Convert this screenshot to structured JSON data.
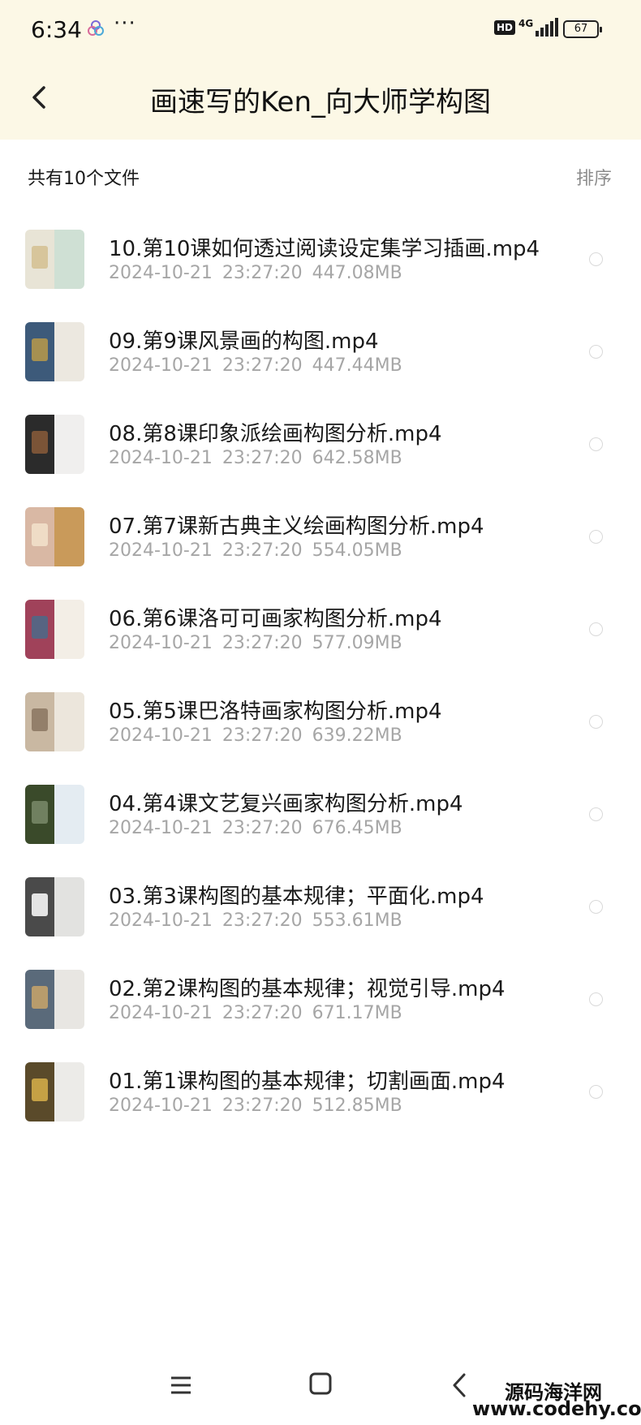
{
  "status_bar": {
    "time": "6:34",
    "more": "···",
    "hd": "HD",
    "network": "4G",
    "battery": "67"
  },
  "header": {
    "title": "画速写的Ken_向大师学构图"
  },
  "list_header": {
    "count_label": "共有10个文件",
    "sort_label": "排序"
  },
  "files": [
    {
      "name": "10.第10课如何透过阅读设定集学习插画.mp4",
      "date": "2024-10-21",
      "time": "23:27:20",
      "size": "447.08MB",
      "thumb": [
        "#e8e4d6",
        "#cfe0d4",
        "#d4c090"
      ]
    },
    {
      "name": "09.第9课风景画的构图.mp4",
      "date": "2024-10-21",
      "time": "23:27:20",
      "size": "447.44MB",
      "thumb": [
        "#3d5a7a",
        "#ece8e0",
        "#b89a4a"
      ]
    },
    {
      "name": "08.第8课印象派绘画构图分析.mp4",
      "date": "2024-10-21",
      "time": "23:27:20",
      "size": "642.58MB",
      "thumb": [
        "#2b2b2b",
        "#f0efee",
        "#8a5c3a"
      ]
    },
    {
      "name": "07.第7课新古典主义绘画构图分析.mp4",
      "date": "2024-10-21",
      "time": "23:27:20",
      "size": "554.05MB",
      "thumb": [
        "#d9b8a4",
        "#c99a5a",
        "#f2e2cc"
      ]
    },
    {
      "name": "06.第6课洛可可画家构图分析.mp4",
      "date": "2024-10-21",
      "time": "23:27:20",
      "size": "577.09MB",
      "thumb": [
        "#a0425a",
        "#f3eee6",
        "#4a6a8a"
      ]
    },
    {
      "name": "05.第5课巴洛特画家构图分析.mp4",
      "date": "2024-10-21",
      "time": "23:27:20",
      "size": "639.22MB",
      "thumb": [
        "#c9b8a2",
        "#ece6dc",
        "#8a7460"
      ]
    },
    {
      "name": "04.第4课文艺复兴画家构图分析.mp4",
      "date": "2024-10-21",
      "time": "23:27:20",
      "size": "676.45MB",
      "thumb": [
        "#3a4a2a",
        "#e4ecf2",
        "#7a8a6a"
      ]
    },
    {
      "name": "03.第3课构图的基本规律；平面化.mp4",
      "date": "2024-10-21",
      "time": "23:27:20",
      "size": "553.61MB",
      "thumb": [
        "#4a4a4a",
        "#e2e2e0",
        "#ffffff"
      ]
    },
    {
      "name": "02.第2课构图的基本规律；视觉引导.mp4",
      "date": "2024-10-21",
      "time": "23:27:20",
      "size": "671.17MB",
      "thumb": [
        "#5a6a7a",
        "#e8e6e2",
        "#c9a46a"
      ]
    },
    {
      "name": "01.第1课构图的基本规律；切割画面.mp4",
      "date": "2024-10-21",
      "time": "23:27:20",
      "size": "512.85MB",
      "thumb": [
        "#5a4a2a",
        "#ecebe8",
        "#d8b04a"
      ]
    }
  ],
  "watermark": {
    "name": "源码海洋网",
    "url": "www.codehy.com"
  }
}
